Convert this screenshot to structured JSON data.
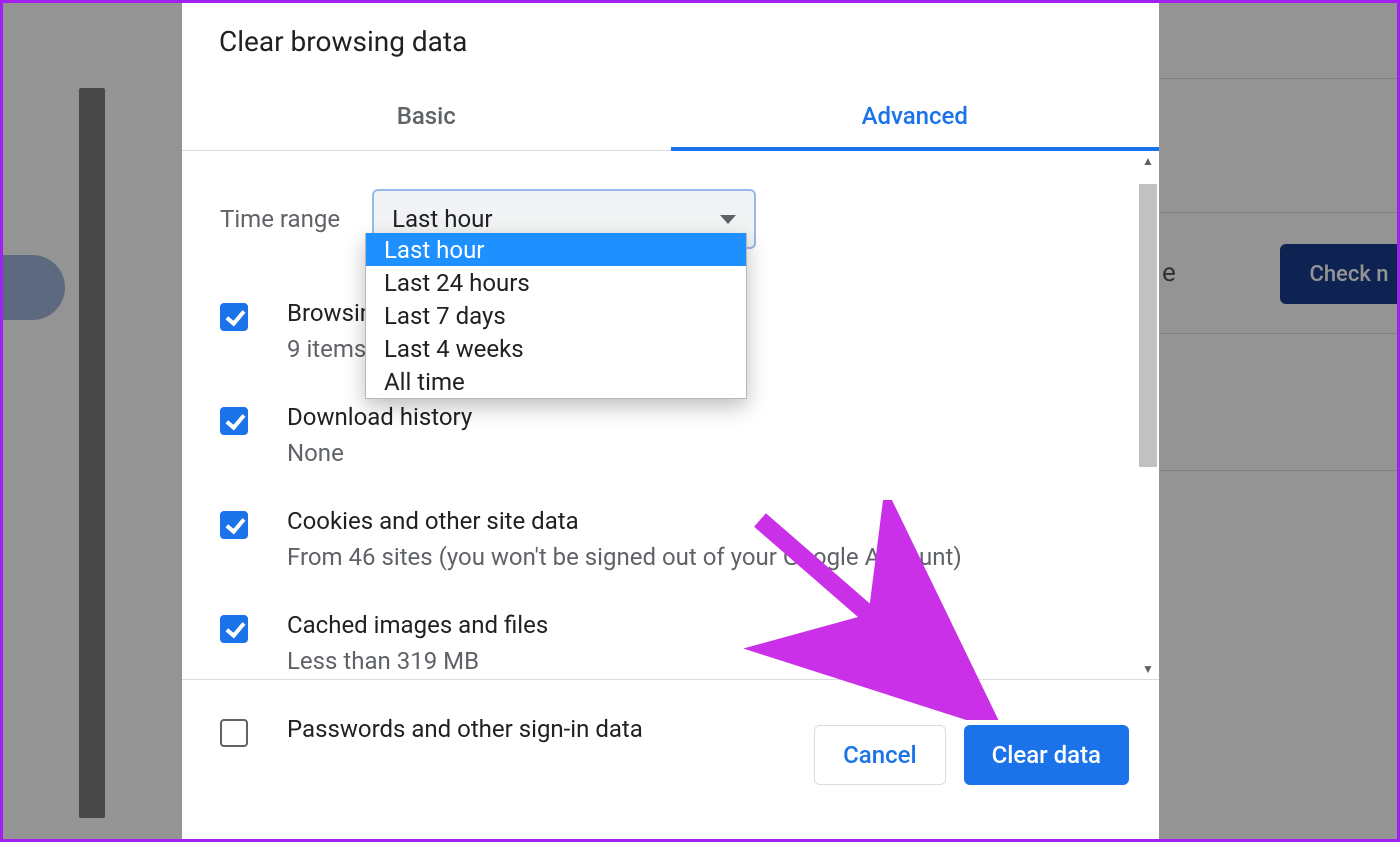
{
  "dialog": {
    "title": "Clear browsing data",
    "tabs": {
      "basic": "Basic",
      "advanced": "Advanced"
    },
    "time_range_label": "Time range",
    "select_value": "Last hour",
    "dropdown_options": [
      "Last hour",
      "Last 24 hours",
      "Last 7 days",
      "Last 4 weeks",
      "All time"
    ],
    "items": [
      {
        "title": "Browsing history",
        "subtitle": "9 items",
        "checked": true
      },
      {
        "title": "Download history",
        "subtitle": "None",
        "checked": true
      },
      {
        "title": "Cookies and other site data",
        "subtitle": "From 46 sites (you won't be signed out of your Google Account)",
        "checked": true
      },
      {
        "title": "Cached images and files",
        "subtitle": "Less than 319 MB",
        "checked": true
      },
      {
        "title": "Passwords and other sign-in data",
        "subtitle": "",
        "checked": false
      }
    ],
    "footer": {
      "cancel": "Cancel",
      "clear": "Clear data"
    }
  },
  "background": {
    "button": "Check n",
    "letter": "e"
  }
}
